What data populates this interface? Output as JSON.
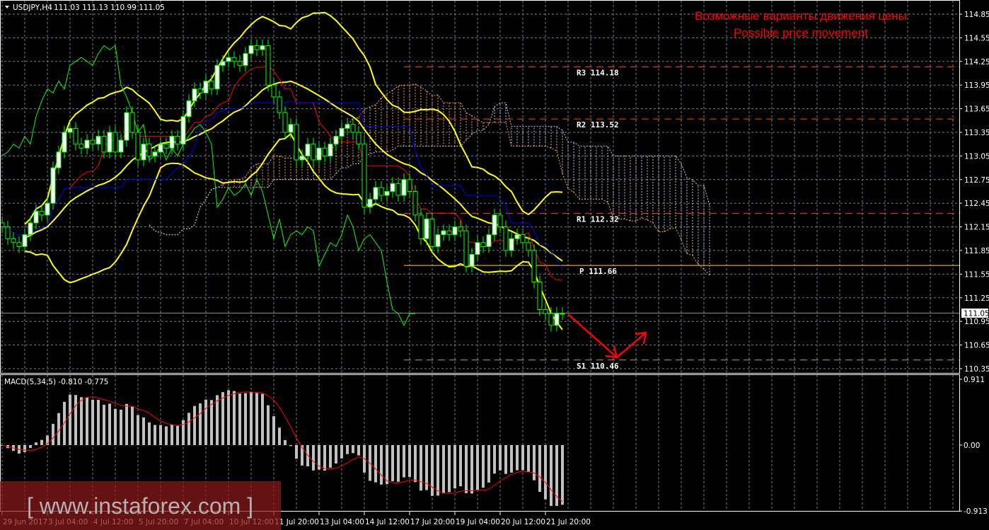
{
  "header": {
    "symbol": "USDJPY,H4",
    "ohlc": "111.03 111.13 110.99 111.05"
  },
  "annotation": {
    "line1": "Возможные варианты движения цены",
    "line2": "Possible price movement"
  },
  "macd_label": "MACD(5,34,5) -0.810 -0.775",
  "watermark": "[ www.instaforex.com ]",
  "chart_data": {
    "type": "candlestick",
    "symbol": "USDJPY",
    "timeframe": "H4",
    "closes": [
      112.15,
      112.0,
      111.95,
      111.9,
      112.05,
      112.2,
      112.35,
      112.3,
      112.45,
      112.9,
      113.1,
      113.35,
      113.4,
      113.2,
      113.15,
      113.25,
      113.2,
      113.3,
      113.1,
      113.35,
      113.1,
      113.25,
      113.6,
      113.35,
      113.0,
      113.2,
      113.05,
      113.1,
      113.2,
      113.15,
      113.3,
      113.2,
      113.55,
      113.75,
      113.9,
      113.85,
      114.0,
      113.9,
      114.2,
      114.25,
      114.3,
      114.25,
      114.2,
      114.35,
      114.45,
      114.4,
      114.45,
      113.95,
      113.8,
      113.6,
      113.35,
      113.45,
      113.0,
      113.05,
      113.2,
      113.0,
      113.15,
      113.05,
      113.2,
      113.3,
      113.4,
      113.45,
      113.35,
      113.2,
      112.4,
      112.5,
      112.65,
      112.55,
      112.6,
      112.7,
      112.55,
      112.75,
      112.6,
      112.3,
      112.0,
      112.25,
      111.9,
      112.05,
      112.1,
      112.05,
      112.15,
      112.1,
      111.65,
      111.8,
      111.95,
      111.9,
      112.05,
      112.3,
      112.15,
      111.85,
      112.0,
      112.05,
      111.95,
      111.85,
      111.45,
      111.1,
      111.05,
      110.9,
      111.05,
      111.05
    ],
    "price_ticks": [
      "114.85",
      "114.55",
      "114.25",
      "113.95",
      "113.65",
      "113.35",
      "113.05",
      "112.75",
      "112.45",
      "112.15",
      "111.85",
      "111.55",
      "111.25",
      "110.95",
      "110.65",
      "110.35"
    ],
    "ylim": [
      110.35,
      114.85
    ],
    "time_labels": [
      {
        "label": "29 Jun 2017",
        "index": 0
      },
      {
        "label": "3 Jul 04:00",
        "index": 8
      },
      {
        "label": "4 Jul 12:00",
        "index": 16
      },
      {
        "label": "5 Jul 20:00",
        "index": 24
      },
      {
        "label": "7 Jul 04:00",
        "index": 32
      },
      {
        "label": "10 Jul 12:00",
        "index": 40
      },
      {
        "label": "11 Jul 20:00",
        "index": 48
      },
      {
        "label": "13 Jul 04:00",
        "index": 56
      },
      {
        "label": "14 Jul 12:00",
        "index": 64
      },
      {
        "label": "17 Jul 20:00",
        "index": 72
      },
      {
        "label": "19 Jul 04:00",
        "index": 80
      },
      {
        "label": "20 Jul 12:00",
        "index": 88
      },
      {
        "label": "21 Jul 20:00",
        "index": 96
      }
    ],
    "pivots": [
      {
        "name": "R3",
        "value": "114.18",
        "style": "dashed",
        "color": "#FF4500"
      },
      {
        "name": "R2",
        "value": "113.52",
        "style": "dashed",
        "color": "#FF4500"
      },
      {
        "name": "R1",
        "value": "112.32",
        "style": "dashed",
        "color": "#FF4500"
      },
      {
        "name": "P",
        "value": "111.66",
        "style": "solid",
        "color": "#FFD700"
      },
      {
        "name": "S1",
        "value": "110.46",
        "style": "dashed",
        "color": "#BC8F8F"
      }
    ],
    "current_price": "111.05",
    "indicators": {
      "bollinger": {
        "period": 20,
        "deviation": 2,
        "color": "#FFFF00"
      },
      "ichimoku": {
        "tenkan": 9,
        "kijun": 26,
        "senkou": 52,
        "tenkan_color": "#FF0000",
        "kijun_color": "#0000FF",
        "chikou_color": "#00FF00",
        "span_a_color": "#F4A460",
        "span_b_color": "#D8BFD8"
      },
      "macd": {
        "fast": 5,
        "slow": 34,
        "signal": 5,
        "hist_color": "#C0C0C0",
        "signal_color": "#FF0000",
        "ticks": [
          "0.911",
          "0.00",
          "-0.913"
        ],
        "range": [
          -0.913,
          0.911
        ]
      }
    },
    "colors": {
      "background": "#000000",
      "grid": "#708090",
      "candle": "#00FF00",
      "bull_body": "#FFFFFF",
      "bear_body": "#000000",
      "annotation": "#FF0000"
    }
  }
}
